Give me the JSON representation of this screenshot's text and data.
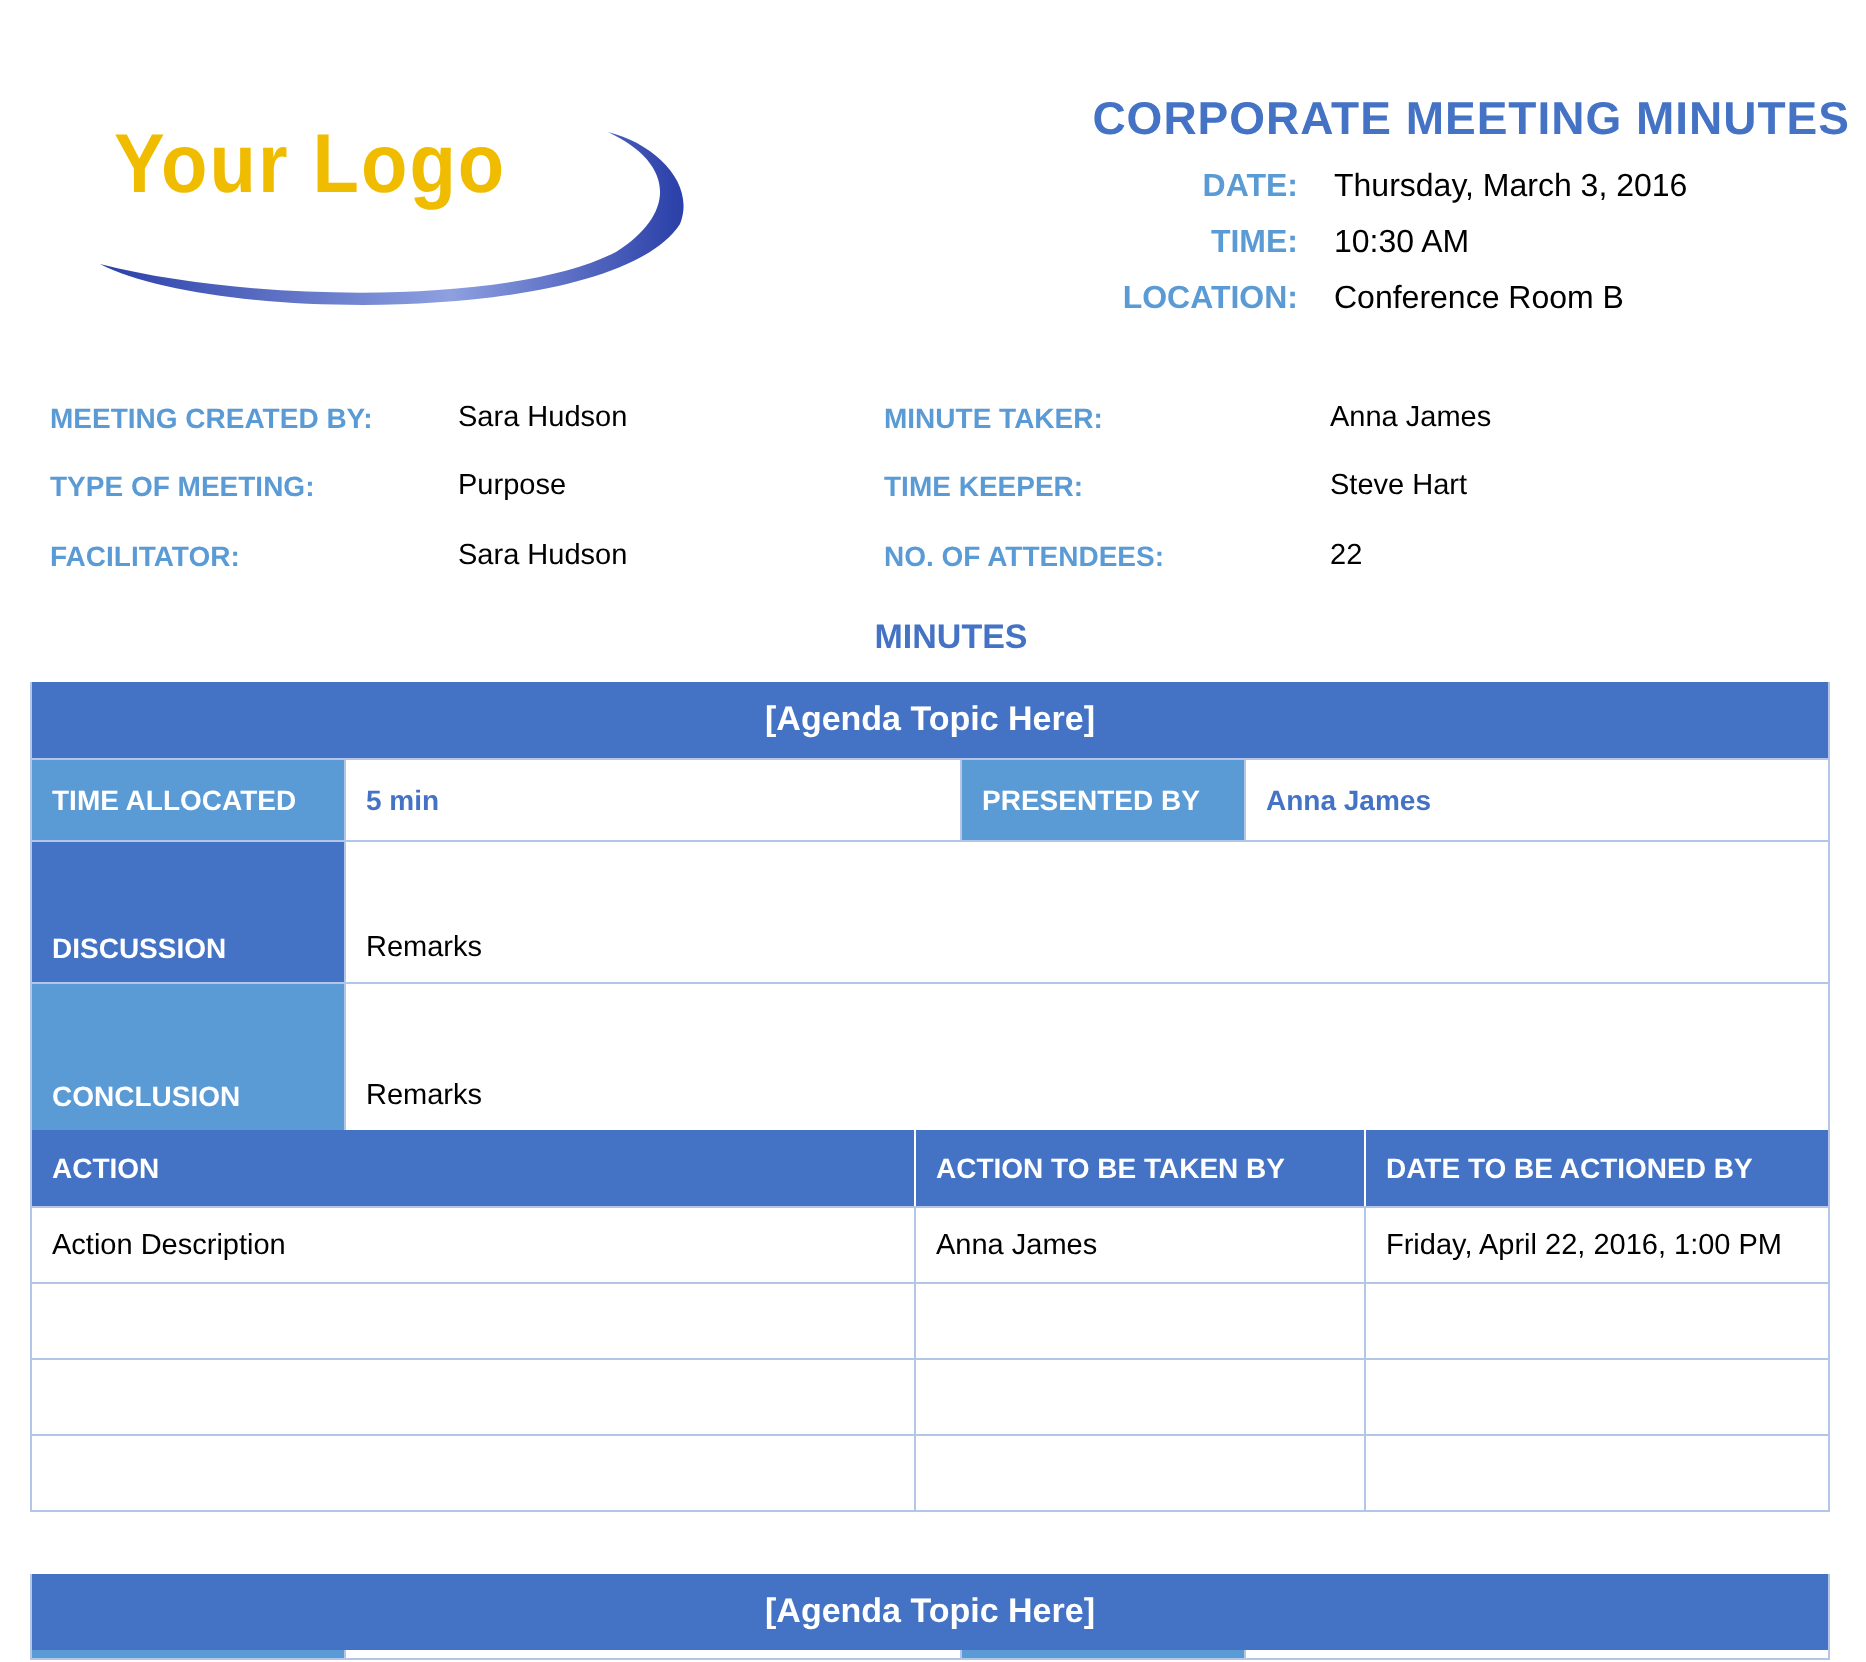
{
  "logo": {
    "text": "Your Logo"
  },
  "title": "CORPORATE MEETING MINUTES",
  "header_fields": [
    {
      "label": "DATE:",
      "value": "Thursday, March 3, 2016"
    },
    {
      "label": "TIME:",
      "value": "10:30 AM"
    },
    {
      "label": "LOCATION:",
      "value": "Conference Room B"
    }
  ],
  "info_fields": [
    {
      "label": "MEETING CREATED BY:",
      "value": "Sara Hudson"
    },
    {
      "label": "MINUTE TAKER:",
      "value": "Anna James"
    },
    {
      "label": "TYPE OF MEETING:",
      "value": "Purpose"
    },
    {
      "label": "TIME KEEPER:",
      "value": "Steve Hart"
    },
    {
      "label": "FACILITATOR:",
      "value": "Sara Hudson"
    },
    {
      "label": "NO. OF ATTENDEES:",
      "value": "22"
    }
  ],
  "section_title": "MINUTES",
  "agenda_items": [
    {
      "topic": "[Agenda Topic Here]",
      "time_allocated_label": "TIME ALLOCATED",
      "time_allocated": "5 min",
      "presented_by_label": "PRESENTED BY",
      "presented_by": "Anna James",
      "discussion_label": "DISCUSSION",
      "discussion": "Remarks",
      "conclusion_label": "CONCLUSION",
      "conclusion": "Remarks",
      "action_columns": [
        "ACTION",
        "ACTION TO BE TAKEN BY",
        "DATE TO BE ACTIONED BY"
      ],
      "action_rows": [
        [
          "Action Description",
          "Anna James",
          "Friday, April 22, 2016, 1:00 PM"
        ]
      ]
    },
    {
      "topic": "[Agenda Topic Here]"
    }
  ]
}
